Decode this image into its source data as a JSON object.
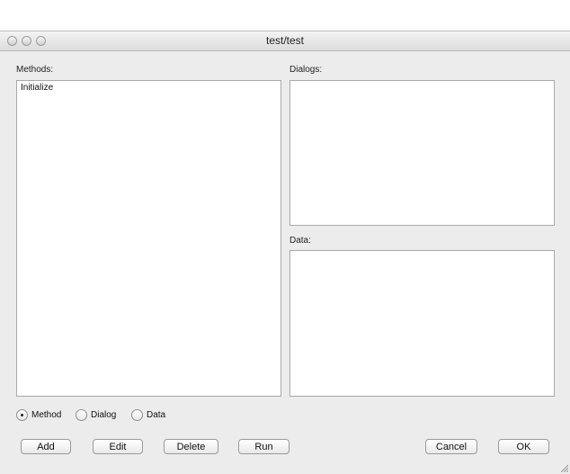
{
  "window": {
    "title": "test/test"
  },
  "methods": {
    "label": "Methods:",
    "items": [
      "Initialize"
    ]
  },
  "dialogs": {
    "label": "Dialogs:"
  },
  "data_panel": {
    "label": "Data:"
  },
  "radios": [
    {
      "label": "Method",
      "checked": true
    },
    {
      "label": "Dialog",
      "checked": false
    },
    {
      "label": "Data",
      "checked": false
    }
  ],
  "buttons": {
    "add": "Add",
    "edit": "Edit",
    "delete": "Delete",
    "run": "Run",
    "cancel": "Cancel",
    "ok": "OK"
  }
}
